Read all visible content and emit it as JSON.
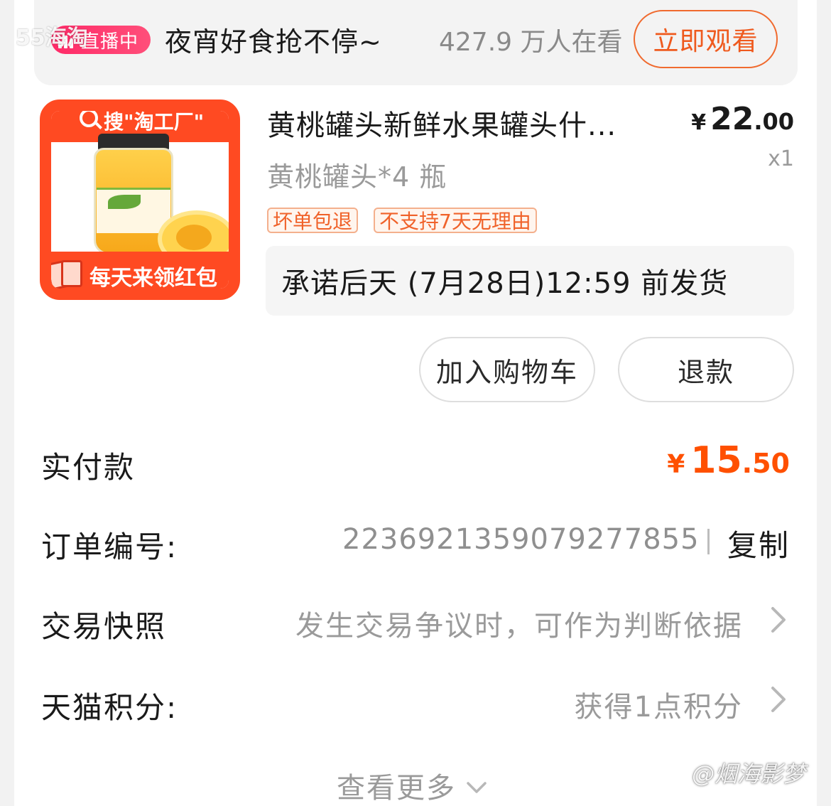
{
  "corner_watermark": "55海淘",
  "live": {
    "badge": "直播中",
    "title": "夜宵好食抢不停~",
    "viewers": "427.9 万人在看",
    "watch_button": "立即观看"
  },
  "product": {
    "image_top_text": "搜\"淘工厂\"",
    "image_bottom_text": "每天来领红包",
    "title": "黄桃罐头新鲜水果罐头什...",
    "price_currency": "¥",
    "price_int": "22",
    "price_dec": ".00",
    "variant": "黄桃罐头*4 瓶",
    "quantity": "x1",
    "tags": [
      "坏单包退",
      "不支持7天无理由"
    ],
    "promise": "承诺后天 (7月28日)12:59 前发货",
    "buttons": {
      "add_to_cart": "加入购物车",
      "refund": "退款"
    }
  },
  "payment": {
    "label": "实付款",
    "currency": "¥",
    "int": "15",
    "dec": ".50"
  },
  "order": {
    "label": "订单编号:",
    "number": "2236921359079277855",
    "separator": "|",
    "copy": "复制"
  },
  "snapshot": {
    "label": "交易快照",
    "value": "发生交易争议时，可作为判断依据"
  },
  "points": {
    "label": "天猫积分:",
    "value": "获得1点积分"
  },
  "more": "查看更多",
  "watermark": "@烟海影梦",
  "colors": {
    "accent_orange": "#ff5000",
    "live_pink": "#ff2a68",
    "tag_orange": "#f0622a"
  }
}
